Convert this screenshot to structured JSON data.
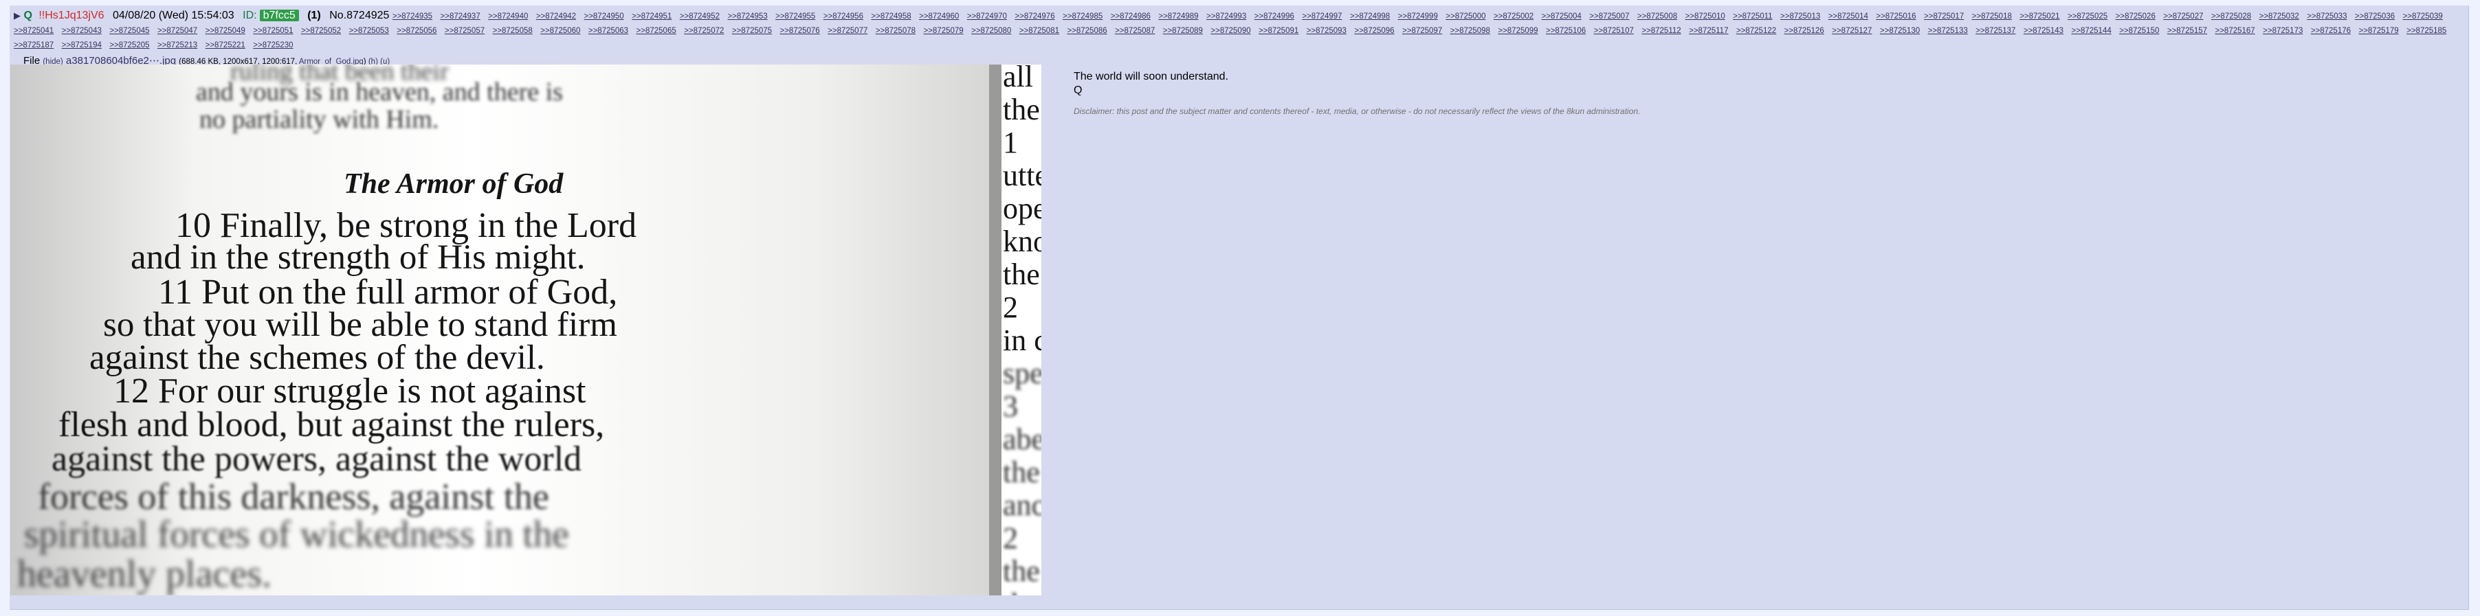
{
  "post": {
    "arrow": "▶",
    "name": "Q",
    "tripcode": "!!Hs1Jq13jV6",
    "date": "04/08/20 (Wed) 15:54:03",
    "id_label": "ID:",
    "id_value": "b7fcc5",
    "id_count": "(1)",
    "post_number": "No.8724925",
    "replies": [
      ">>8724935",
      ">>8724937",
      ">>8724940",
      ">>8724942",
      ">>8724950",
      ">>8724951",
      ">>8724952",
      ">>8724953",
      ">>8724955",
      ">>8724956",
      ">>8724958",
      ">>8724960",
      ">>8724970",
      ">>8724976",
      ">>8724985",
      ">>8724986",
      ">>8724989",
      ">>8724993",
      ">>8724996",
      ">>8724997",
      ">>8724998",
      ">>8724999",
      ">>8725000",
      ">>8725002",
      ">>8725004",
      ">>8725007",
      ">>8725008",
      ">>8725010",
      ">>8725011",
      ">>8725013",
      ">>8725014",
      ">>8725016",
      ">>8725017",
      ">>8725018",
      ">>8725021",
      ">>8725025",
      ">>8725026",
      ">>8725027",
      ">>8725028",
      ">>8725032",
      ">>8725033",
      ">>8725036",
      ">>8725039",
      ">>8725041",
      ">>8725043",
      ">>8725045",
      ">>8725047",
      ">>8725049",
      ">>8725051",
      ">>8725052",
      ">>8725053",
      ">>8725056",
      ">>8725057",
      ">>8725058",
      ">>8725060",
      ">>8725063",
      ">>8725065",
      ">>8725072",
      ">>8725075",
      ">>8725076",
      ">>8725077",
      ">>8725078",
      ">>8725079",
      ">>8725080",
      ">>8725081",
      ">>8725086",
      ">>8725087",
      ">>8725089",
      ">>8725090",
      ">>8725091",
      ">>8725093",
      ">>8725096",
      ">>8725097",
      ">>8725098",
      ">>8725099",
      ">>8725106",
      ">>8725107",
      ">>8725112",
      ">>8725117",
      ">>8725122",
      ">>8725126",
      ">>8725127",
      ">>8725130",
      ">>8725133",
      ">>8725137",
      ">>8725143",
      ">>8725144",
      ">>8725150",
      ">>8725157",
      ">>8725167",
      ">>8725173",
      ">>8725176",
      ">>8725179",
      ">>8725185",
      ">>8725187",
      ">>8725194",
      ">>8725205",
      ">>8725213",
      ">>8725221",
      ">>8725230"
    ],
    "file": {
      "label": "File",
      "hide": "(hide)",
      "filename": "a381708604bf6e2⋯.jpg",
      "meta_open": "(",
      "size": "688.46 KB, 1200x617, 1200:617,",
      "original_name": "Armor_of_God.jpg",
      "close": ")",
      "ext1": "(h)",
      "ext2": "(u)"
    },
    "message": [
      "The world will soon understand.",
      "Q"
    ],
    "disclaimer": "Disclaimer: this post and the subject matter and contents thereof - text, media, or otherwise - do not necessarily reflect the views of the 8kun administration."
  },
  "image": {
    "alt_name": "Armor_of_God.jpg",
    "heading": "The Armor of God",
    "lines": [
      "10 Finally, be strong in the Lord",
      "and in the strength of His might.",
      "11 Put on the full armor of God,",
      "so that you will be able to stand firm",
      "against the schemes of the devil.",
      "12 For our struggle is not against",
      "flesh and blood, but against the rulers,",
      "against the powers, against the world",
      "forces of this darkness, against the",
      "spiritual forces of wickedness in the",
      "heavenly places."
    ],
    "top_lines": [
      "ruling that been their",
      "and yours is in heaven, and there is",
      "no partiality with Him."
    ],
    "side_words": [
      "all",
      "the",
      "1",
      "utte",
      "ope",
      "kno",
      "the",
      "2",
      "in c",
      "spe",
      "3",
      "abe",
      "the",
      "anc",
      "2",
      "the",
      "da"
    ]
  }
}
